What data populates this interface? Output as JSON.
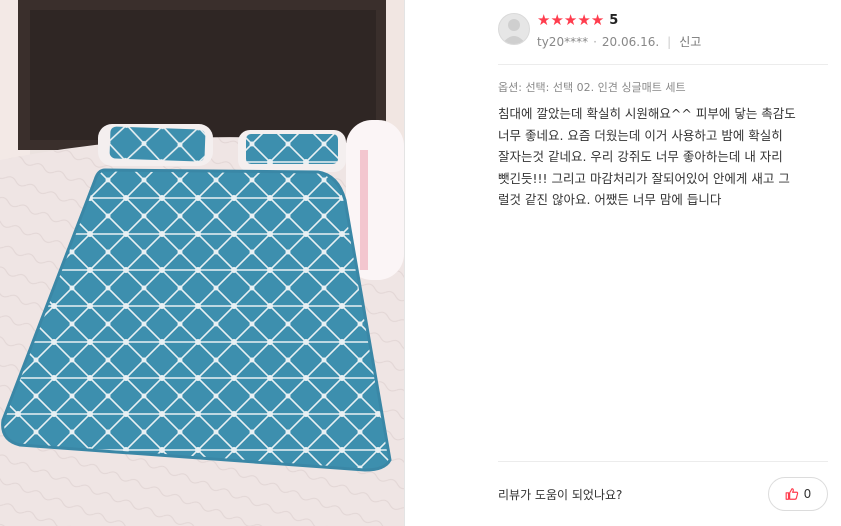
{
  "review": {
    "rating": 5,
    "rating_label": "5",
    "stars": [
      "★",
      "★",
      "★",
      "★",
      "★"
    ],
    "star_color": "#ff3d4e",
    "author": "ty20****",
    "date": "20.06.16.",
    "report_label": "신고",
    "option_text": "옵션: 선택: 선택 02. 인견 싱글매트 세트",
    "text": "침대에 깔았는데 확실히 시원해요^^ 피부에 닿는 촉감도\n너무 좋네요. 요즘 더웠는데 이거 사용하고 밤에 확실히\n잘자는것 같네요. 우리 강쥐도 너무 좋아하는데 내 자리\n뺏긴듯!!! 그리고 마감처리가 잘되어있어 안에게 새고 그\n럴것 같진 않아요. 어쨌든 너무 맘에 듭니다"
  },
  "helpful": {
    "question": "리뷰가 도움이 되었나요?",
    "count": "0",
    "icon": "thumbs-up-icon"
  },
  "photo": {
    "mat_color": "#3d8fae",
    "pattern_color": "#e8f0f3"
  }
}
